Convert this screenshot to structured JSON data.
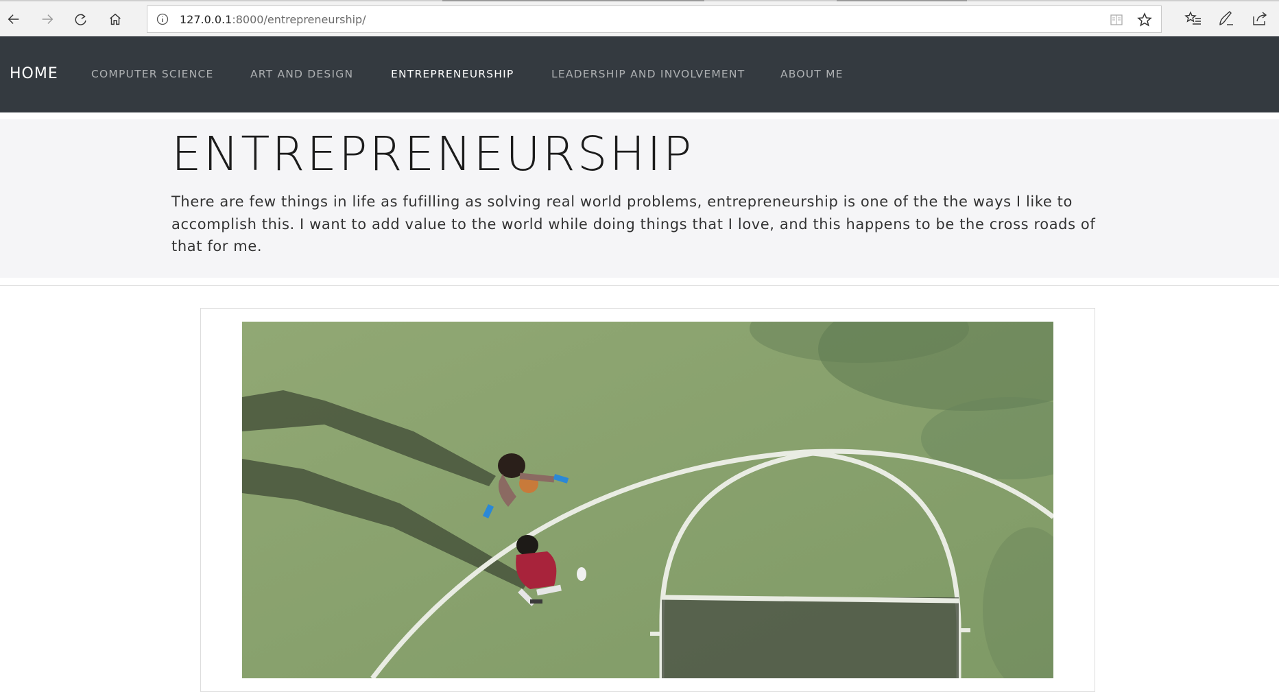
{
  "browser": {
    "url_host": "127.0.0.1",
    "url_path": ":8000/entrepreneurship/",
    "icons": [
      "back-icon",
      "forward-icon",
      "refresh-icon",
      "home-icon",
      "site-info-icon",
      "reading-view-icon",
      "favorite-star-icon",
      "favorites-list-icon",
      "pen-icon",
      "share-icon"
    ]
  },
  "navbar": {
    "brand": "HOME",
    "items": [
      {
        "label": "COMPUTER SCIENCE",
        "active": false
      },
      {
        "label": "ART AND DESIGN",
        "active": false
      },
      {
        "label": "ENTREPRENEURSHIP",
        "active": true
      },
      {
        "label": "LEADERSHIP AND INVOLVEMENT",
        "active": false
      },
      {
        "label": "ABOUT ME",
        "active": false
      }
    ],
    "background": "#343a40"
  },
  "header": {
    "title": "ENTREPRENEURSHIP",
    "lead": "There are few things in life as fufilling as solving real world problems, entrepreneurship is one of the the ways I like to accomplish this. I want to add value to the world while doing things that I love, and this happens to be the cross roads of that for me."
  },
  "main": {
    "image": {
      "subject": "aerial view of two people on a green basketball court",
      "court_color": "#8ea56f"
    }
  }
}
